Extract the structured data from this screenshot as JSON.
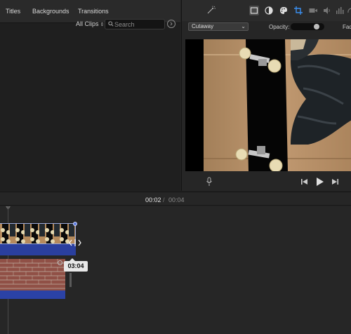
{
  "browser": {
    "tabs": [
      {
        "label": "Titles"
      },
      {
        "label": "Backgrounds"
      },
      {
        "label": "Transitions"
      }
    ],
    "clips_filter": "All Clips",
    "search": {
      "placeholder": "Search",
      "value": ""
    }
  },
  "viewer": {
    "toolbar_icons": [
      "magic-wand-icon",
      "video-overlay-icon",
      "color-balance-icon",
      "color-correction-icon",
      "crop-icon",
      "stabilization-icon",
      "volume-icon",
      "noise-reduction-icon",
      "speed-icon"
    ],
    "overlay_mode": "Cutaway",
    "opacity_label": "Opacity:",
    "opacity_value": 0.85,
    "fade_label": "Fade"
  },
  "playback": {
    "current": "00:02",
    "separator": "/",
    "total": "00:04"
  },
  "timeline": {
    "duration_tooltip": "03:04"
  },
  "colors": {
    "accent": "#3b6fd6",
    "audio_track": "#2b42a6",
    "background": "#232323"
  }
}
